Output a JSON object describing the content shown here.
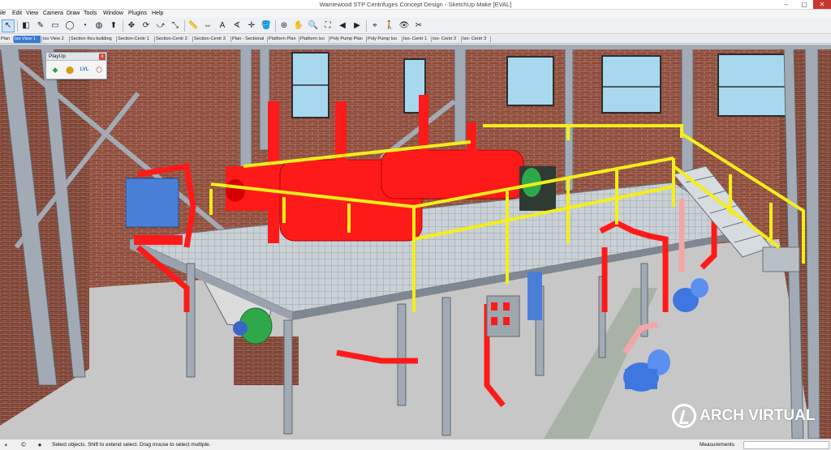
{
  "window": {
    "title": "Warriewood STP Centrifuges Concept Design - SketchUp Make [EVAL]",
    "minimize_glyph": "‒",
    "restore_glyph": "▢",
    "close_glyph": "✕"
  },
  "menu": [
    "ile",
    "Edit",
    "View",
    "Camera",
    "Draw",
    "Tools",
    "Window",
    "Plugins",
    "Help"
  ],
  "toolbar": {
    "icons": [
      "select-icon",
      "eraser-icon",
      "pencil-icon",
      "rectangle-icon",
      "circle-icon",
      "arc-icon",
      "offset-icon",
      "push-pull-icon",
      "move-icon",
      "rotate-icon",
      "follow-me-icon",
      "scale-icon",
      "tape-measure-icon",
      "dimension-icon",
      "text-icon",
      "protractor-icon",
      "axes-icon",
      "paint-bucket-icon",
      "orbit-icon",
      "pan-icon",
      "zoom-icon",
      "zoom-extents-icon",
      "previous-view-icon",
      "next-view-icon",
      "position-camera-icon",
      "walk-icon",
      "look-around-icon",
      "section-plane-icon"
    ],
    "glyphs": [
      "↖",
      "◧",
      "✎",
      "▭",
      "◯",
      "◔",
      "◍",
      "⬆",
      "✥",
      "⟳",
      "⤻",
      "⤡",
      "📏",
      "⇔",
      "A",
      "∢",
      "✛",
      "🪣",
      "⊛",
      "✋",
      "🔍",
      "⛶",
      "◀",
      "▶",
      "⌖",
      "🚶",
      "👁",
      "✂"
    ],
    "selected": 0
  },
  "scene_tabs": [
    "Plan",
    "Iso View 1",
    "Iso View 2",
    "Section thru building",
    "Section-Centr 1",
    "Section-Centr 2",
    "Section-Centr 3",
    "Plan - Sectional",
    "Platform Plan",
    "Platform Iso",
    "Poly Pump Plan",
    "Poly Pump Iso",
    "Iso- Centr 1",
    "Iso- Centr 2",
    "Iso- Centr 3"
  ],
  "active_tab": 1,
  "playup": {
    "title": "PlayUp",
    "close": "x",
    "buttons": [
      {
        "icon": "export-icon",
        "glyph": "◆",
        "color": "#3a9a4a"
      },
      {
        "icon": "location-icon",
        "glyph": "⬤",
        "color": "#d99a1c"
      },
      {
        "icon": "level-icon",
        "glyph": "LVL",
        "color": "#2a6ebb"
      },
      {
        "icon": "settings-icon",
        "glyph": "⬡",
        "color": "#c0392b"
      }
    ]
  },
  "watermark": "ARCH VIRTUAL",
  "status": {
    "message": "Select objects. Shift to extend select. Drag mouse to select multiple.",
    "measurements_label": "Measurements",
    "measurements_value": "",
    "icons": [
      "geo-location-icon",
      "credits-icon",
      "user-icon"
    ],
    "glyphs": [
      "◐",
      "©",
      "●"
    ]
  },
  "colors": {
    "brick": "#8f4a3a",
    "steel": "#9aa3ad",
    "centrifuge": "#ff1a1a",
    "handrail": "#f5ee1a",
    "motor": "#4a7fd8",
    "green_motor": "#2fa84a",
    "window_sky": "#a8d8ee",
    "floor": "#c4c4c4"
  }
}
